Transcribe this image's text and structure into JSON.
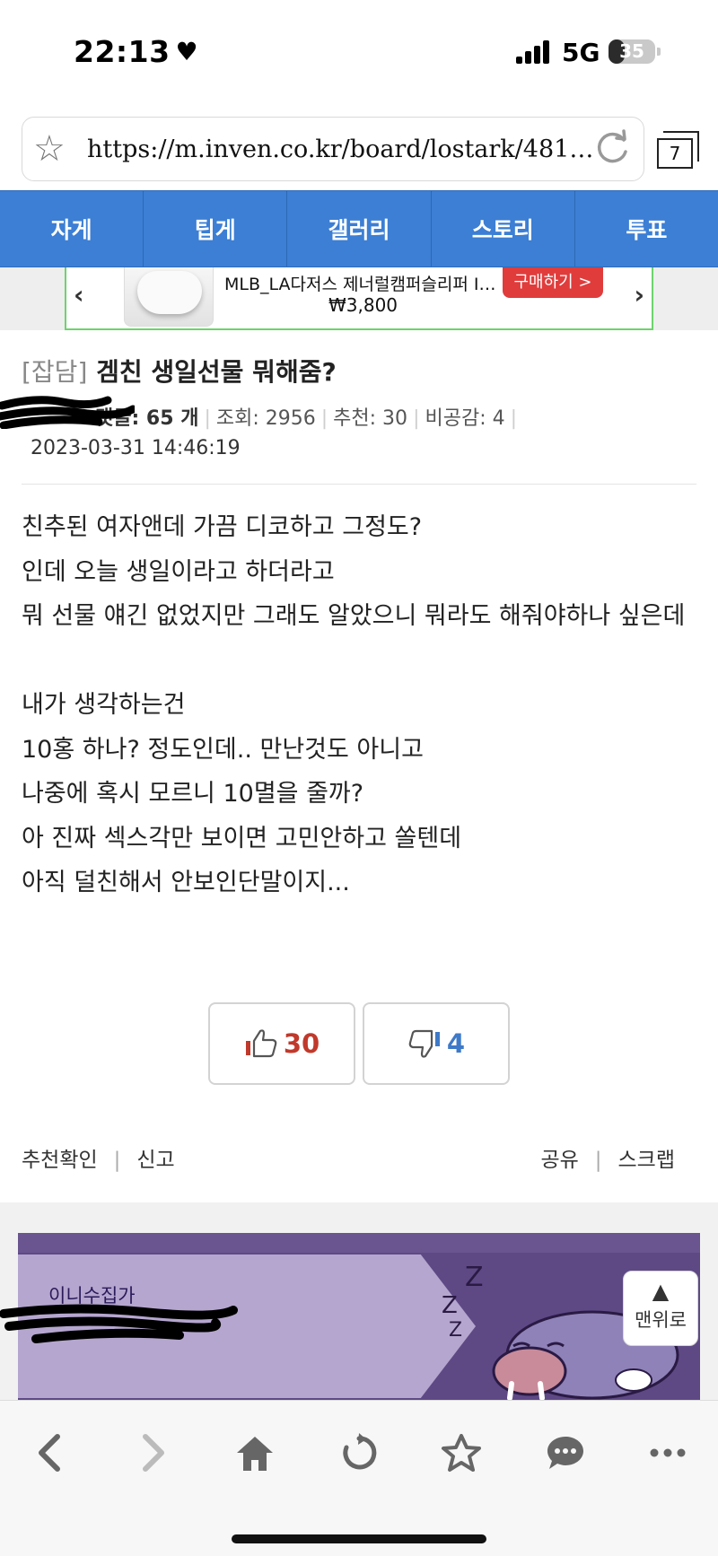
{
  "status_bar": {
    "time": "22:13",
    "network": "5G",
    "battery": "35",
    "battery_level": 0.35
  },
  "browser": {
    "url": "https://m.inven.co.kr/board/lostark/4811/6…",
    "tab_count": "7"
  },
  "nav": {
    "items": [
      {
        "label": "자게"
      },
      {
        "label": "팁게"
      },
      {
        "label": "갤러리"
      },
      {
        "label": "스토리"
      },
      {
        "label": "투표"
      }
    ]
  },
  "ad": {
    "title": "MLB_LA다저스 제너럴캠퍼슬리퍼 IV…",
    "price": "₩3,800",
    "buy_label": "구매하기 >"
  },
  "post": {
    "category": "[잡담]",
    "title": "겜친 생일선물 뭐해줌?",
    "comments": "댓글: 65 개",
    "views": "조회: 2956",
    "likes_meta": "추천: 30",
    "dislikes_meta": "비공감: 4",
    "date": "2023-03-31 14:46:19",
    "body": [
      "친추된 여자앤데 가끔 디코하고 그정도?",
      "인데 오늘 생일이라고 하더라고",
      "뭐 선물 얘긴 없었지만 그래도 알았으니 뭐라도 해줘야하나 싶은데",
      "",
      "내가 생각하는건",
      "10홍 하나? 정도인데.. 만난것도 아니고",
      "나중에 혹시 모르니 10멸을 줄까?",
      "아 진짜 섹스각만 보이면 고민안하고 쏠텐데",
      "아직 덜친해서 안보인단말이지..."
    ]
  },
  "votes": {
    "up": "30",
    "down": "4"
  },
  "actions": {
    "recommend_check": "추천확인",
    "report": "신고",
    "share": "공유",
    "scrap": "스크랩"
  },
  "profile": {
    "label": "이니수집가"
  },
  "to_top": {
    "label": "맨위로"
  },
  "colors": {
    "nav_bg": "#3c7fd4",
    "up_vote": "#c0392b",
    "down_vote": "#3f7ac8",
    "ad_buy": "#e03c3c",
    "profile_bg": "#6b5590"
  }
}
